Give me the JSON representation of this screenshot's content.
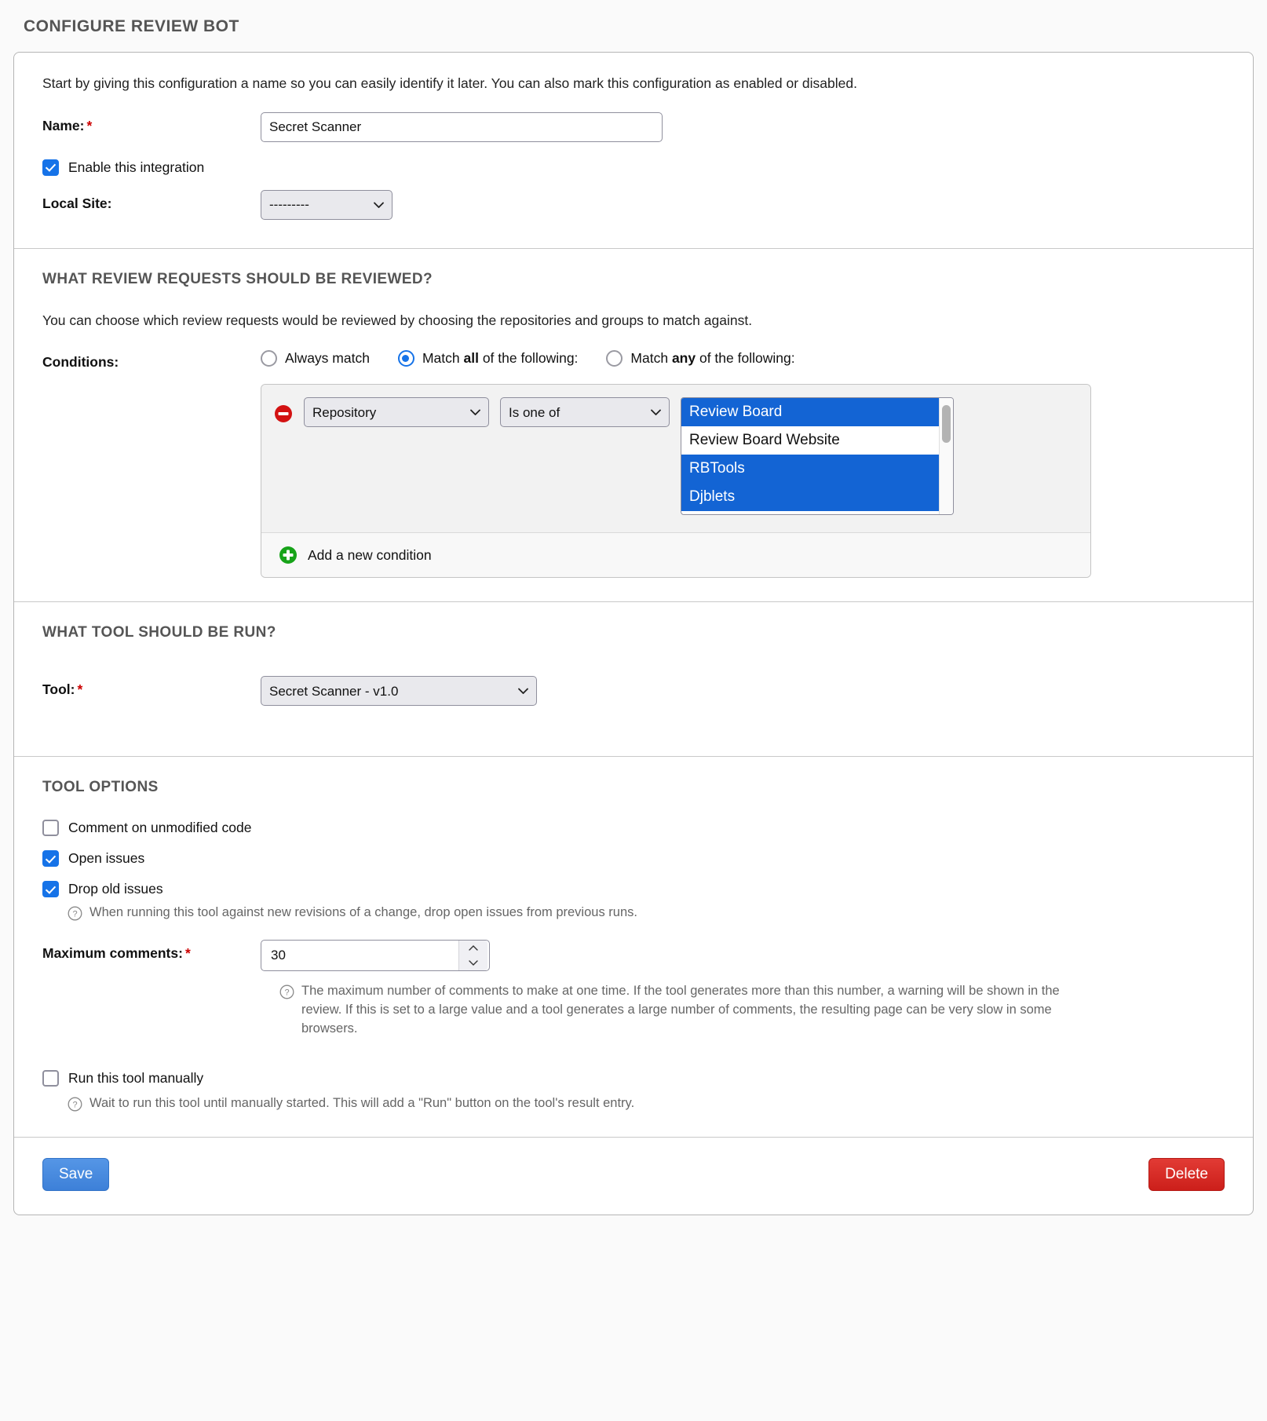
{
  "page": {
    "title": "Configure Review Bot"
  },
  "basic": {
    "intro": "Start by giving this configuration a name so you can easily identify it later. You can also mark this configuration as enabled or disabled.",
    "name_label": "Name:",
    "name_value": "Secret Scanner",
    "name_placeholder": "",
    "enable_label": "Enable this integration",
    "enable_checked": true,
    "local_site_label": "Local Site:",
    "local_site_value": "---------",
    "local_site_options": [
      "---------"
    ]
  },
  "conditions_section": {
    "heading": "What review requests should be reviewed?",
    "intro": "You can choose which review requests would be reviewed by choosing the repositories and groups to match against.",
    "label": "Conditions:",
    "modes": [
      {
        "label_prefix": "Always match",
        "label_bold": "",
        "label_suffix": "",
        "selected": false
      },
      {
        "label_prefix": "Match ",
        "label_bold": "all",
        "label_suffix": " of the following:",
        "selected": true
      },
      {
        "label_prefix": "Match ",
        "label_bold": "any",
        "label_suffix": " of the following:",
        "selected": false
      }
    ],
    "rows": [
      {
        "field_value": "Repository",
        "field_options": [
          "Repository"
        ],
        "operator_value": "Is one of",
        "operator_options": [
          "Is one of"
        ],
        "choices": [
          {
            "label": "Review Board",
            "selected": true
          },
          {
            "label": "Review Board Website",
            "selected": false
          },
          {
            "label": "RBTools",
            "selected": true
          },
          {
            "label": "Djblets",
            "selected": true
          }
        ]
      }
    ],
    "add_label": "Add a new condition",
    "remove_icon": "remove-circle-icon",
    "add_icon": "add-circle-icon"
  },
  "tool_section": {
    "heading": "What tool should be run?",
    "tool_label": "Tool:",
    "tool_value": "Secret Scanner - v1.0",
    "tool_options": [
      "Secret Scanner - v1.0"
    ]
  },
  "tool_options": {
    "heading": "Tool options",
    "checkboxes": [
      {
        "label": "Comment on unmodified code",
        "checked": false
      },
      {
        "label": "Open issues",
        "checked": true
      },
      {
        "label": "Drop old issues",
        "checked": true
      }
    ],
    "drop_old_issues_help": "When running this tool against new revisions of a change, drop open issues from previous runs.",
    "max_comments_label": "Maximum comments:",
    "max_comments_value": "30",
    "max_comments_help": "The maximum number of comments to make at one time. If the tool generates more than this number, a warning will be shown in the review. If this is set to a large value and a tool generates a large number of comments, the resulting page can be very slow in some browsers.",
    "run_manually_label": "Run this tool manually",
    "run_manually_checked": false,
    "run_manually_help": "Wait to run this tool until manually started. This will add a \"Run\" button on the tool's result entry."
  },
  "buttons": {
    "save_label": "Save",
    "delete_label": "Delete"
  },
  "colors": {
    "accent_blue": "#1673e8",
    "selection_blue": "#1364d4",
    "required_red": "#cc0000",
    "delete_red": "#cc1f1a",
    "save_blue": "#3d80d8",
    "add_green": "#17a319",
    "remove_red": "#d31212"
  }
}
